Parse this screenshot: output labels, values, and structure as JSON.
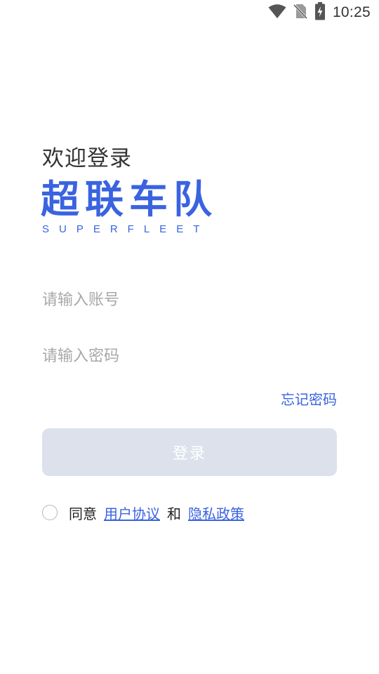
{
  "status_bar": {
    "time": "10:25",
    "icons": [
      "wifi-icon",
      "no-sim-icon",
      "battery-charging-icon"
    ]
  },
  "login": {
    "welcome": "欢迎登录",
    "brand_cn": "超联车队",
    "brand_en": "SUPERFLEET",
    "account_placeholder": "请输入账号",
    "password_placeholder": "请输入密码",
    "forgot_password": "忘记密码",
    "login_button": "登录",
    "agree_prefix": "同意",
    "user_agreement": "用户协议",
    "and": "和",
    "privacy_policy": "隐私政策"
  },
  "colors": {
    "accent": "#3A63E0",
    "button_disabled": "#DDE1EC",
    "placeholder": "#A8A8A8",
    "text": "#333333"
  }
}
